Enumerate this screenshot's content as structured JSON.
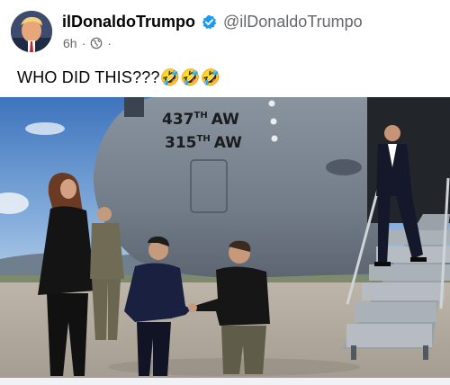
{
  "post": {
    "author": "ilDonaldoTrumpo",
    "handle": "@ilDonaldoTrumpo",
    "time": "6h",
    "dot": "·",
    "audience_icon": "globe-icon",
    "text": "WHO DID THIS???",
    "emoji": "🤣🤣🤣",
    "verified_icon": "verified-badge-icon",
    "verified_color": "#1d9bf0"
  },
  "photo": {
    "plane_markings": [
      "437TH AW",
      "315TH AW"
    ],
    "plane_line1": "437",
    "plane_line1_sup": "TH",
    "plane_line1_unit": "AW",
    "plane_line2": "315",
    "plane_line2_sup": "TH",
    "plane_line2_unit": "AW"
  },
  "colors": {
    "sky": "#5b8ec9",
    "fuselage": "#7b8591",
    "tarmac": "#b0a99d"
  }
}
